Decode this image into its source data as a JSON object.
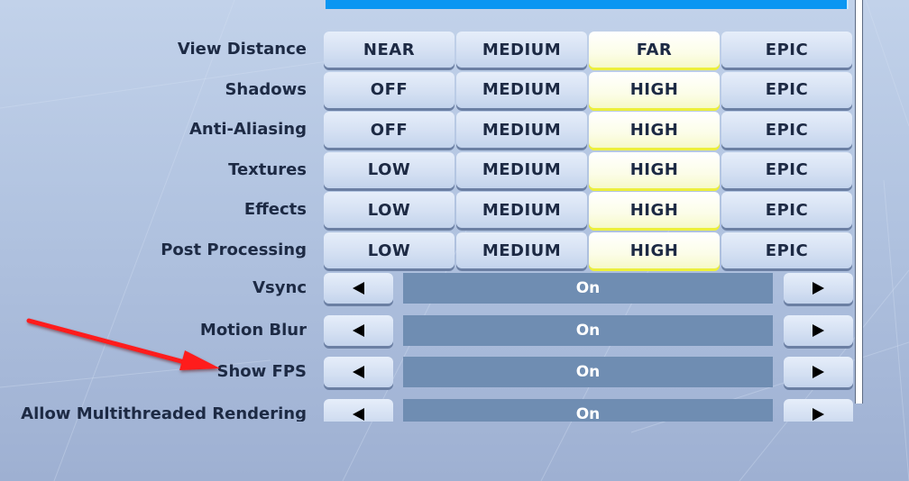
{
  "colors": {
    "selected_glow": "#ecef3c",
    "value_box": "#6f8db2",
    "top_bar": "#0a96f2",
    "label_text": "#1d2a44",
    "annotation_arrow": "#ff1a1a"
  },
  "quality_settings": [
    {
      "label": "View Distance",
      "options": [
        "NEAR",
        "MEDIUM",
        "FAR",
        "EPIC"
      ],
      "selected": "FAR"
    },
    {
      "label": "Shadows",
      "options": [
        "OFF",
        "MEDIUM",
        "HIGH",
        "EPIC"
      ],
      "selected": "HIGH"
    },
    {
      "label": "Anti-Aliasing",
      "options": [
        "OFF",
        "MEDIUM",
        "HIGH",
        "EPIC"
      ],
      "selected": "HIGH"
    },
    {
      "label": "Textures",
      "options": [
        "LOW",
        "MEDIUM",
        "HIGH",
        "EPIC"
      ],
      "selected": "HIGH"
    },
    {
      "label": "Effects",
      "options": [
        "LOW",
        "MEDIUM",
        "HIGH",
        "EPIC"
      ],
      "selected": "HIGH"
    },
    {
      "label": "Post Processing",
      "options": [
        "LOW",
        "MEDIUM",
        "HIGH",
        "EPIC"
      ],
      "selected": "HIGH"
    }
  ],
  "toggle_settings": [
    {
      "label": "Vsync",
      "value": "On",
      "left_icon": "arrow-left-icon",
      "right_icon": "arrow-right-icon"
    },
    {
      "label": "Motion Blur",
      "value": "On",
      "left_icon": "arrow-left-icon",
      "right_icon": "arrow-right-icon"
    },
    {
      "label": "Show FPS",
      "value": "On",
      "left_icon": "arrow-left-icon",
      "right_icon": "arrow-right-icon"
    },
    {
      "label": "Allow Multithreaded Rendering",
      "value": "On",
      "left_icon": "arrow-left-icon",
      "right_icon": "arrow-right-icon"
    }
  ],
  "annotation": {
    "type": "red-arrow",
    "points_to": "Show FPS"
  }
}
